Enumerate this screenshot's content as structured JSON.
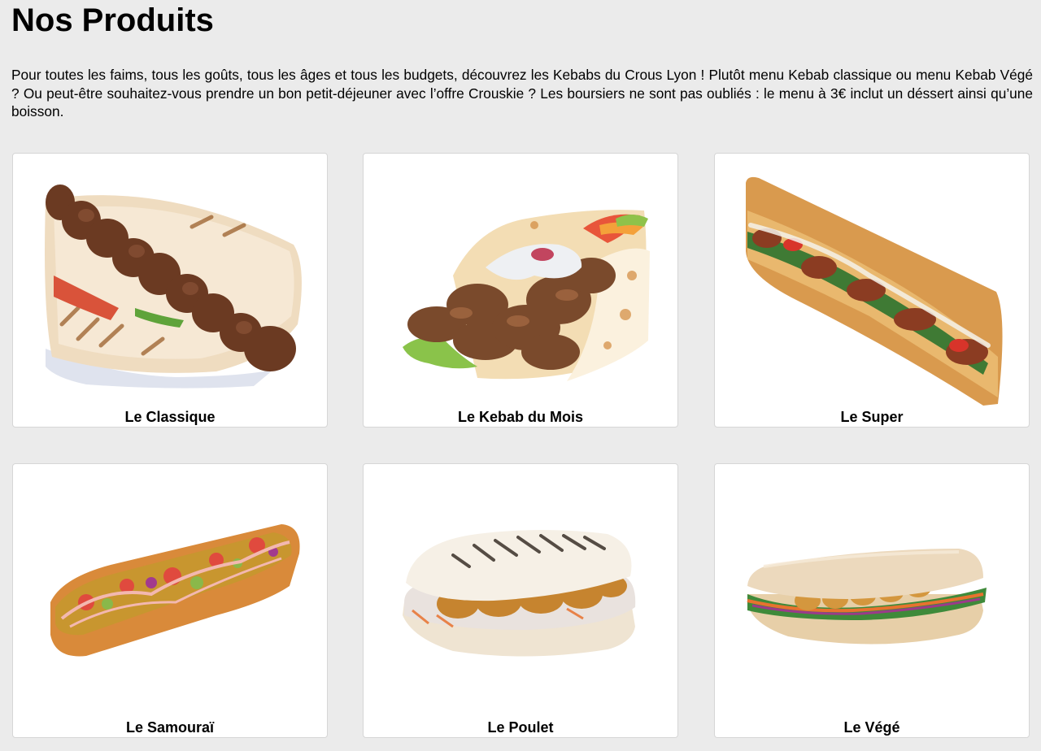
{
  "page": {
    "title": "Nos Produits",
    "intro": "Pour toutes les faims, tous les goûts, tous les âges et tous les budgets, découvrez les Kebabs du Crous Lyon ! Plutôt menu Kebab classique ou menu Kebab Végé ? Ou peut-être souhaitez-vous prendre un bon petit-déjeuner avec l’offre Crouskie ? Les boursiers ne sont pas oubliés : le menu à 3€ inclut un déssert ainsi qu’une boisson."
  },
  "products": [
    {
      "name": "Le Classique",
      "image": "kebab-skewer-flatbread-photo"
    },
    {
      "name": "Le Kebab du Mois",
      "image": "kebab-wrap-photo"
    },
    {
      "name": "Le Super",
      "image": "long-baguette-sandwich-photo"
    },
    {
      "name": "Le Samouraï",
      "image": "loaded-baguette-photo"
    },
    {
      "name": "Le Poulet",
      "image": "grilled-chicken-panini-photo"
    },
    {
      "name": "Le Végé",
      "image": "vegetarian-sandwich-photo"
    }
  ],
  "colors": {
    "background": "#ebebeb",
    "card": "#ffffff",
    "card_border": "#d6d6d6",
    "text": "#000000"
  }
}
